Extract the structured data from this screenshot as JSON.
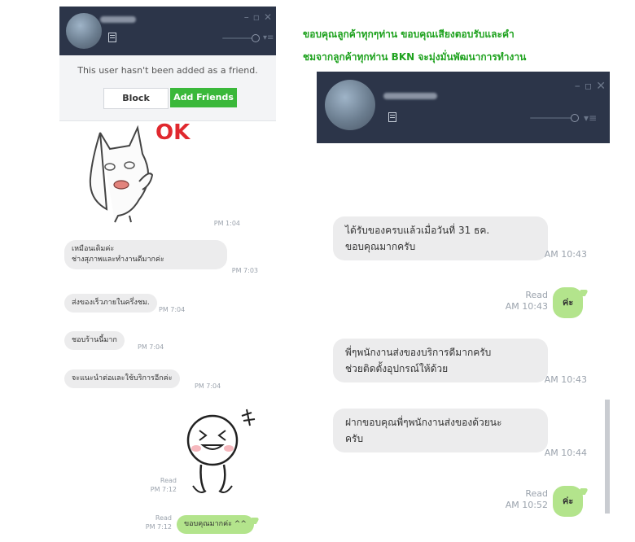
{
  "caption": {
    "line1": "ขอบคุณลูกค้าทุกๆท่าน   ขอบคุณเสียงตอบรับและคำ",
    "line2": "ชมจากลูกค้าทุกท่าน   BKN จะมุ่งมั่นพัฒนาการทำงาน"
  },
  "left_window": {
    "friend_notice": "This user hasn't been added as a friend.",
    "block_label": "Block",
    "add_friends_label": "Add Friends",
    "sticker_ok_text": "OK",
    "sticker_time": "PM 1:04",
    "messages": [
      {
        "text": "เหมือนเดิมค่ะ\nช่างสุภาพและทำงานดีมากค่ะ",
        "time": "PM 7:03"
      },
      {
        "text": "ส่งของเร็วภายในครึ่งชม.",
        "time": "PM 7:04"
      },
      {
        "text": "ชอบร้านนี้มาก",
        "time": "PM 7:04"
      },
      {
        "text": "จะแนะนำต่อและใช้บริการอีกค่ะ",
        "time": "PM 7:04"
      }
    ],
    "sticker2_status": "Read\nPM 7:12",
    "sent_message": {
      "text": "ขอบคุณมากค่ะ ^^",
      "status": "Read\nPM 7:12"
    }
  },
  "right_window": {
    "messages": [
      {
        "text": "ได้รับของครบแล้วเมื่อวันที่ 31 ธค.\nขอบคุณมากครับ",
        "time": "AM 10:43"
      },
      {
        "text": "พี่ๆพนักงานส่งของบริการดีมากครับ\nช่วยติดตั้งอุปกรณ์ให้ด้วย",
        "time": "AM 10:43"
      },
      {
        "text": "ฝากขอบคุณพี่ๆพนักงานส่งของด้วยนะ\nครับ",
        "time": "AM 10:44"
      }
    ],
    "sent": [
      {
        "text": "ค่ะ",
        "status": "Read\nAM 10:43"
      },
      {
        "text": "ค่ะ",
        "status": "Read\nAM 10:52"
      }
    ]
  },
  "colors": {
    "titlebar": "#2c3549",
    "add_button": "#3ab83a",
    "sent_bubble": "#b3e48c",
    "received_bubble": "#ececed",
    "caption": "#1ea21e",
    "sticker_ok": "#e0282e"
  },
  "icons": [
    "minimize-icon",
    "maximize-icon",
    "close-icon",
    "volume-slider",
    "menu-icon",
    "note-icon"
  ]
}
